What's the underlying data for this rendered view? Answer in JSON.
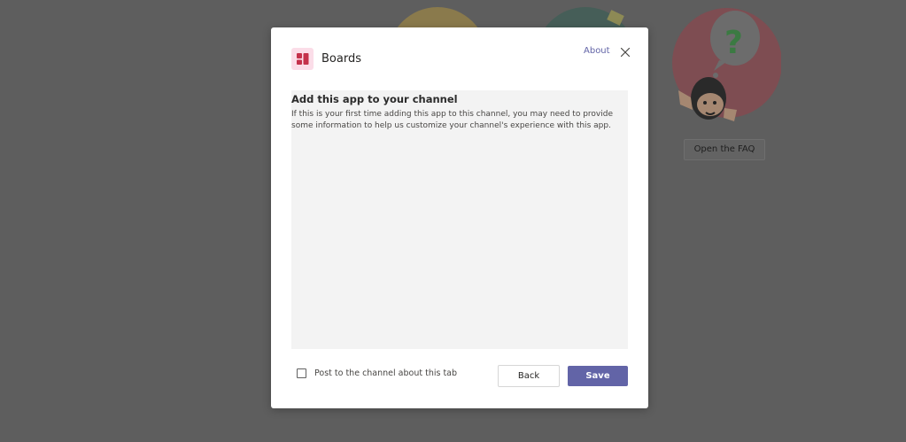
{
  "background": {
    "faq_button_label": "Open the FAQ"
  },
  "dialog": {
    "app_name": "Boards",
    "app_icon": "boards-icon",
    "about_label": "About",
    "close_icon": "close-icon",
    "heading": "Add this app to your channel",
    "body": "If this is your first time adding this app to this channel, you may need to provide some information to help us customize your channel's experience with this app.",
    "post_checkbox": {
      "label": "Post to the channel about this tab",
      "checked": false
    },
    "back_label": "Back",
    "save_label": "Save"
  },
  "colors": {
    "accent": "#6264a7",
    "overlay": "#5e5e5e",
    "app_icon_bg": "#fbdde8",
    "app_icon_fg": "#c4314b"
  }
}
